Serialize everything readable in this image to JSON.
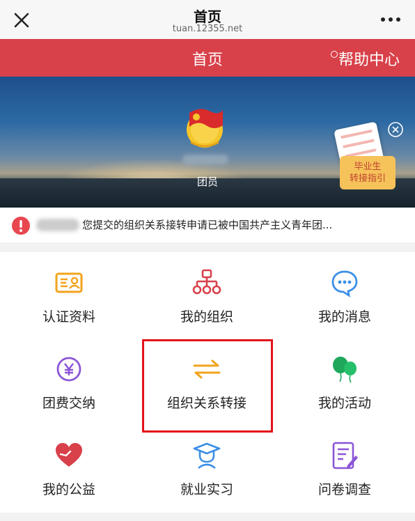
{
  "browser": {
    "title": "首页",
    "url": "tuan.12355.net"
  },
  "header": {
    "title": "首页",
    "help_label": "帮助中心"
  },
  "banner": {
    "role": "团员",
    "graduate_badge": [
      "毕业生",
      "转接指引"
    ]
  },
  "notice": {
    "text": "您提交的组织关系接转申请已被中国共产主义青年团..."
  },
  "menu": [
    {
      "label": "认证资料",
      "icon": "id-card-icon",
      "color": "#f2a31c"
    },
    {
      "label": "我的组织",
      "icon": "org-chart-icon",
      "color": "#d8414a"
    },
    {
      "label": "我的消息",
      "icon": "chat-bubble-icon",
      "color": "#3b8fe6"
    },
    {
      "label": "团费交纳",
      "icon": "yen-coin-icon",
      "color": "#8a55d6"
    },
    {
      "label": "组织关系转接",
      "icon": "transfer-arrows-icon",
      "color": "#f2a31c"
    },
    {
      "label": "我的活动",
      "icon": "balloons-icon",
      "color": "#1fa85c"
    },
    {
      "label": "我的公益",
      "icon": "heart-hands-icon",
      "color": "#d8414a"
    },
    {
      "label": "就业实习",
      "icon": "graduate-icon",
      "color": "#3b8fe6"
    },
    {
      "label": "问卷调查",
      "icon": "survey-icon",
      "color": "#8a55d6"
    }
  ]
}
